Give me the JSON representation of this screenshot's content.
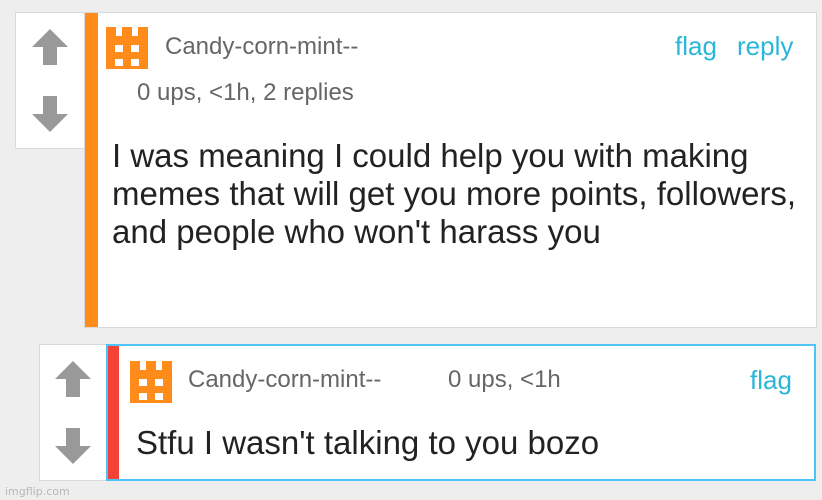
{
  "comments": [
    {
      "username": "Candy-corn-mint--",
      "stats": "0 ups, <1h, 2 replies",
      "flag_label": "flag",
      "reply_label": "reply",
      "body": "I was meaning I could help you with making memes that will get you more points, followers, and people who won't harass you",
      "accent_color": "#ff8c1a",
      "avatar_icon": "castle-icon"
    },
    {
      "username": "Candy-corn-mint--",
      "stats": "0 ups, <1h",
      "flag_label": "flag",
      "body": "Stfu I wasn't talking to you bozo",
      "accent_color": "#f44336",
      "border_color": "#4fc3f7",
      "avatar_icon": "castle-icon"
    }
  ],
  "icons": {
    "upvote": "up-arrow-icon",
    "downvote": "down-arrow-icon"
  },
  "watermark": "imgflip.com"
}
